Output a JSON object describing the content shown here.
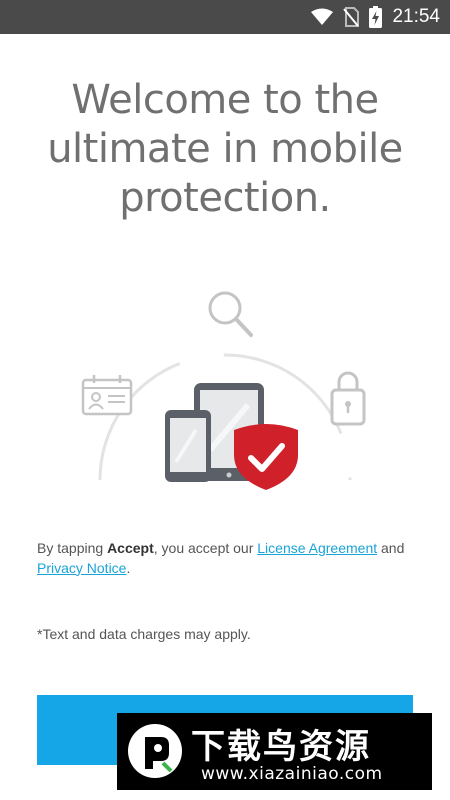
{
  "status_bar": {
    "time": "21:54"
  },
  "welcome": {
    "title": "Welcome to the ultimate in mobile protection."
  },
  "legal": {
    "prefix": "By tapping ",
    "accept_word": "Accept",
    "middle": ", you accept our ",
    "license_link": "License Agreement",
    "and": " and",
    "privacy_link": "Privacy Notice",
    "end": "."
  },
  "charges_note": "*Text and data charges may apply.",
  "accept_button": {
    "label": ""
  },
  "watermark": {
    "title": "下载鸟资源",
    "url": "www.xiazainiao.com"
  },
  "colors": {
    "status_bar": "#4a4a4a",
    "accent": "#14a6e6",
    "shield": "#d0202a",
    "link": "#1aa3d8"
  }
}
